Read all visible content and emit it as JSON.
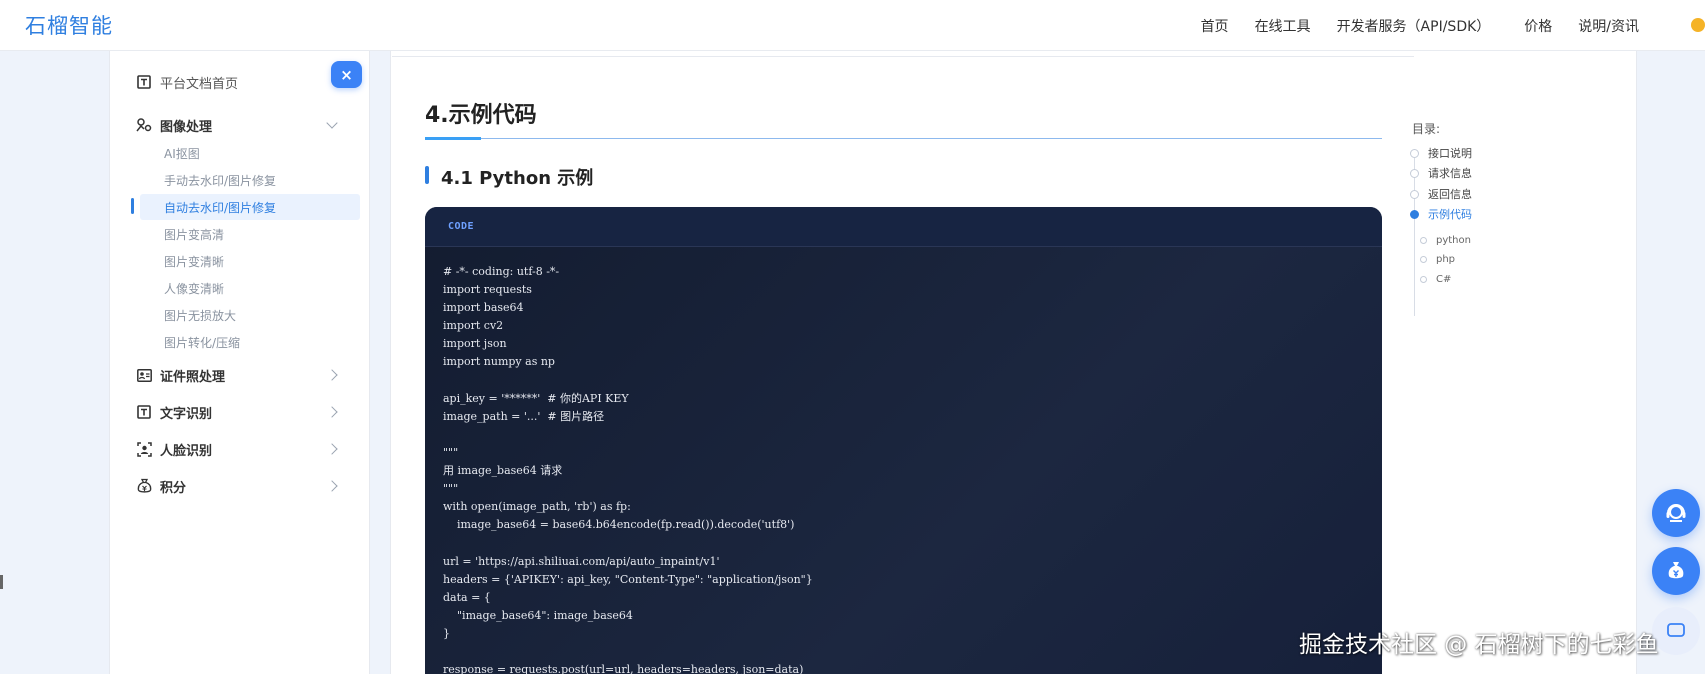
{
  "brand": {
    "logo": "石榴智能"
  },
  "nav": {
    "items": [
      "首页",
      "在线工具",
      "开发者服务（API/SDK）",
      "价格",
      "说明/资讯"
    ]
  },
  "sidebar": {
    "close_label": "×",
    "home_label": "平台文档首页",
    "image_group": {
      "label": "图像处理",
      "items": [
        "AI抠图",
        "手动去水印/图片修复",
        "自动去水印/图片修复",
        "图片变高清",
        "图片变清晰",
        "人像变清晰",
        "图片无损放大",
        "图片转化/压缩"
      ],
      "active_index": 2
    },
    "groups": [
      "证件照处理",
      "文字识别",
      "人脸识别",
      "积分"
    ]
  },
  "main": {
    "section_title": "4.示例代码",
    "subsection_title": "4.1 Python 示例",
    "code_tag": "CODE",
    "code_lines": [
      "# -*- coding: utf-8 -*-",
      "import requests",
      "import base64",
      "import cv2",
      "import json",
      "import numpy as np",
      "",
      "api_key = '******'  # 你的API KEY",
      "image_path = '...'  # 图片路径",
      "",
      "\"\"\"",
      "用 image_base64 请求",
      "\"\"\"",
      "with open(image_path, 'rb') as fp:",
      "    image_base64 = base64.b64encode(fp.read()).decode('utf8')",
      "",
      "url = 'https://api.shiliuai.com/api/auto_inpaint/v1'",
      "headers = {'APIKEY': api_key, \"Content-Type\": \"application/json\"}",
      "data = {",
      "    \"image_base64\": image_base64",
      "}",
      "",
      "response = requests.post(url=url, headers=headers, json=data)"
    ]
  },
  "toc": {
    "title": "目录:",
    "items": [
      "接口说明",
      "请求信息",
      "返回信息",
      "示例代码"
    ],
    "active_index": 3,
    "sub_items": [
      "python",
      "php",
      "C#"
    ]
  },
  "watermark": "掘金技术社区 @ 石榴树下的七彩鱼",
  "colors": {
    "accent": "#2f7fe0",
    "code_bg": "#1a2439",
    "float_button": "#3b82f6"
  }
}
